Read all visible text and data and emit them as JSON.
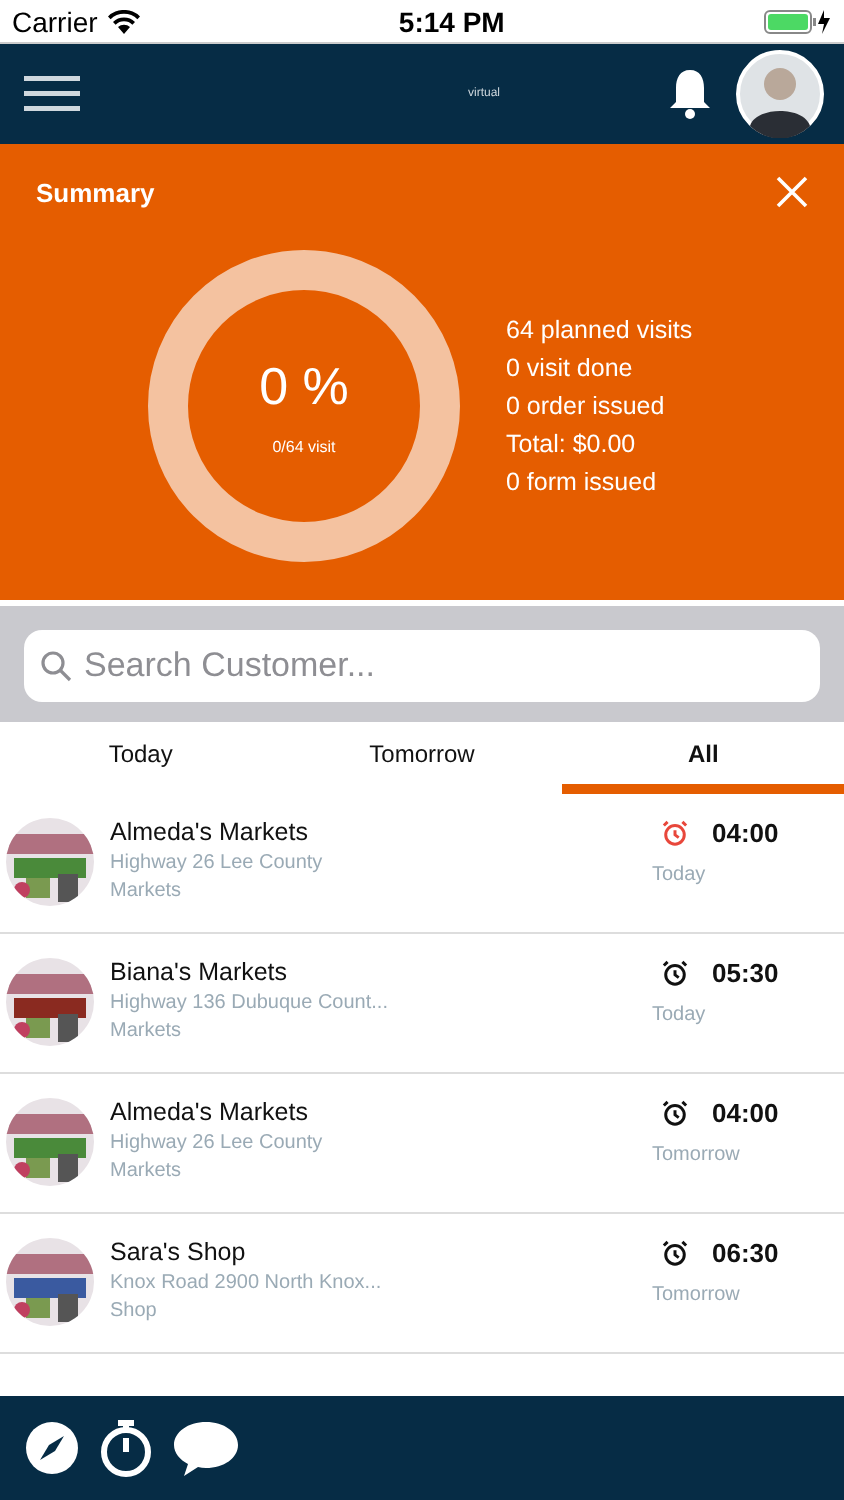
{
  "status_bar": {
    "carrier": "Carrier",
    "time": "5:14 PM"
  },
  "nav": {
    "logo": "virtual"
  },
  "summary": {
    "title": "Summary",
    "percent": "0 %",
    "visits": "0/64 visit",
    "stats": [
      "64 planned visits",
      "0 visit done",
      "0 order issued",
      "Total: $0.00",
      "0 form issued"
    ]
  },
  "search": {
    "placeholder": "Search Customer..."
  },
  "tabs": [
    {
      "label": "Today",
      "selected": false
    },
    {
      "label": "Tomorrow",
      "selected": false
    },
    {
      "label": "All",
      "selected": true
    }
  ],
  "customers": [
    {
      "name": "Almeda's Markets",
      "address": "Highway 26 Lee County",
      "category": "Markets",
      "time": "04:00",
      "day": "Today",
      "overdue": true
    },
    {
      "name": "Biana's Markets",
      "address": "Highway 136 Dubuque Count...",
      "category": "Markets",
      "time": "05:30",
      "day": "Today",
      "overdue": false
    },
    {
      "name": "Almeda's Markets",
      "address": "Highway 26 Lee County",
      "category": "Markets",
      "time": "04:00",
      "day": "Tomorrow",
      "overdue": false
    },
    {
      "name": "Sara's Shop",
      "address": "Knox Road 2900 North Knox...",
      "category": "Shop",
      "time": "06:30",
      "day": "Tomorrow",
      "overdue": false
    }
  ]
}
